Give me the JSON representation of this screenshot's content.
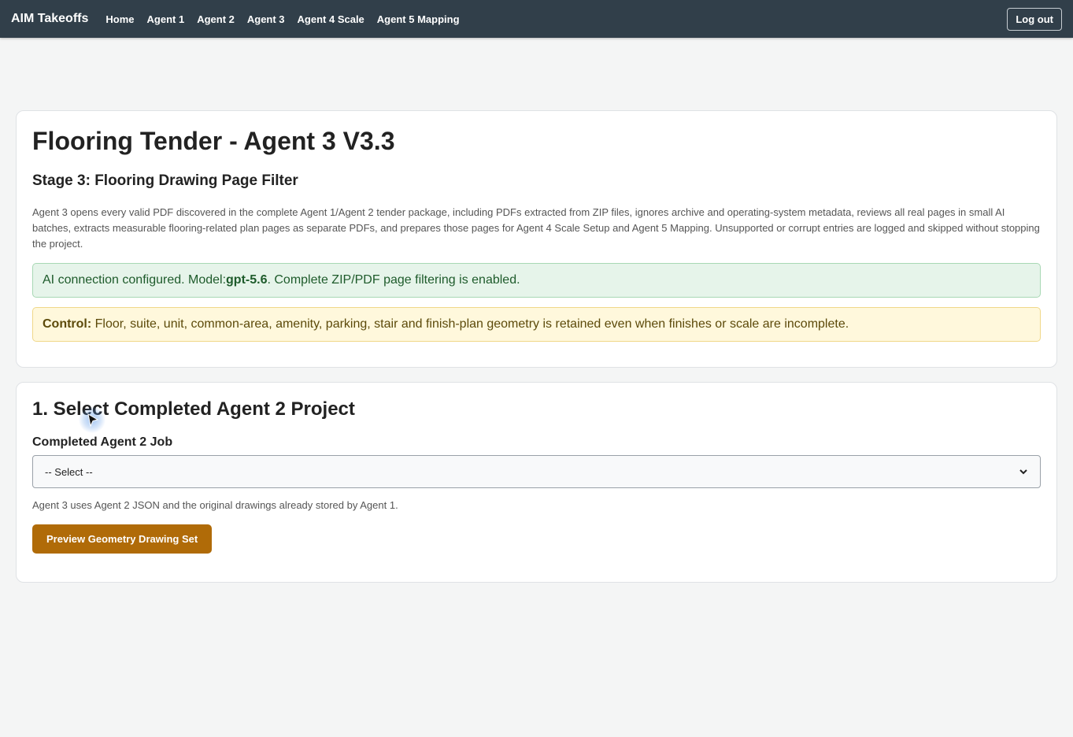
{
  "nav": {
    "brand": "AIM Takeoffs",
    "links": [
      "Home",
      "Agent 1",
      "Agent 2",
      "Agent 3",
      "Agent 4 Scale",
      "Agent 5 Mapping"
    ],
    "logout_label": "Log out"
  },
  "header_card": {
    "title": "Flooring Tender - Agent 3 V3.3",
    "stage": "Stage 3: Flooring Drawing Page Filter",
    "description": "Agent 3 opens every valid PDF discovered in the complete Agent 1/Agent 2 tender package, including PDFs extracted from ZIP files, ignores archive and operating-system metadata, reviews all real pages in small AI batches, extracts measurable flooring-related plan pages as separate PDFs, and prepares those pages for Agent 4 Scale Setup and Agent 5 Mapping. Unsupported or corrupt entries are logged and skipped without stopping the project.",
    "success_prefix": "AI connection configured. Model: ",
    "model": "gpt-5.6",
    "success_suffix": ". Complete ZIP/PDF page filtering is enabled.",
    "control_label": "Control:",
    "control_text": " Floor, suite, unit, common-area, amenity, parking, stair and finish-plan geometry is retained even when finishes or scale are incomplete."
  },
  "select_card": {
    "title": "1. Select Completed Agent 2 Project",
    "field_label": "Completed Agent 2 Job",
    "select_value": "-- Select --",
    "hint": "Agent 3 uses Agent 2 JSON and the original drawings already stored by Agent 1.",
    "button_label": "Preview Geometry Drawing Set"
  },
  "colors": {
    "topbar": "#313f4a",
    "primary_button": "#b06b08",
    "success_bg": "#e6f4ea",
    "warning_bg": "#fff8dc"
  }
}
